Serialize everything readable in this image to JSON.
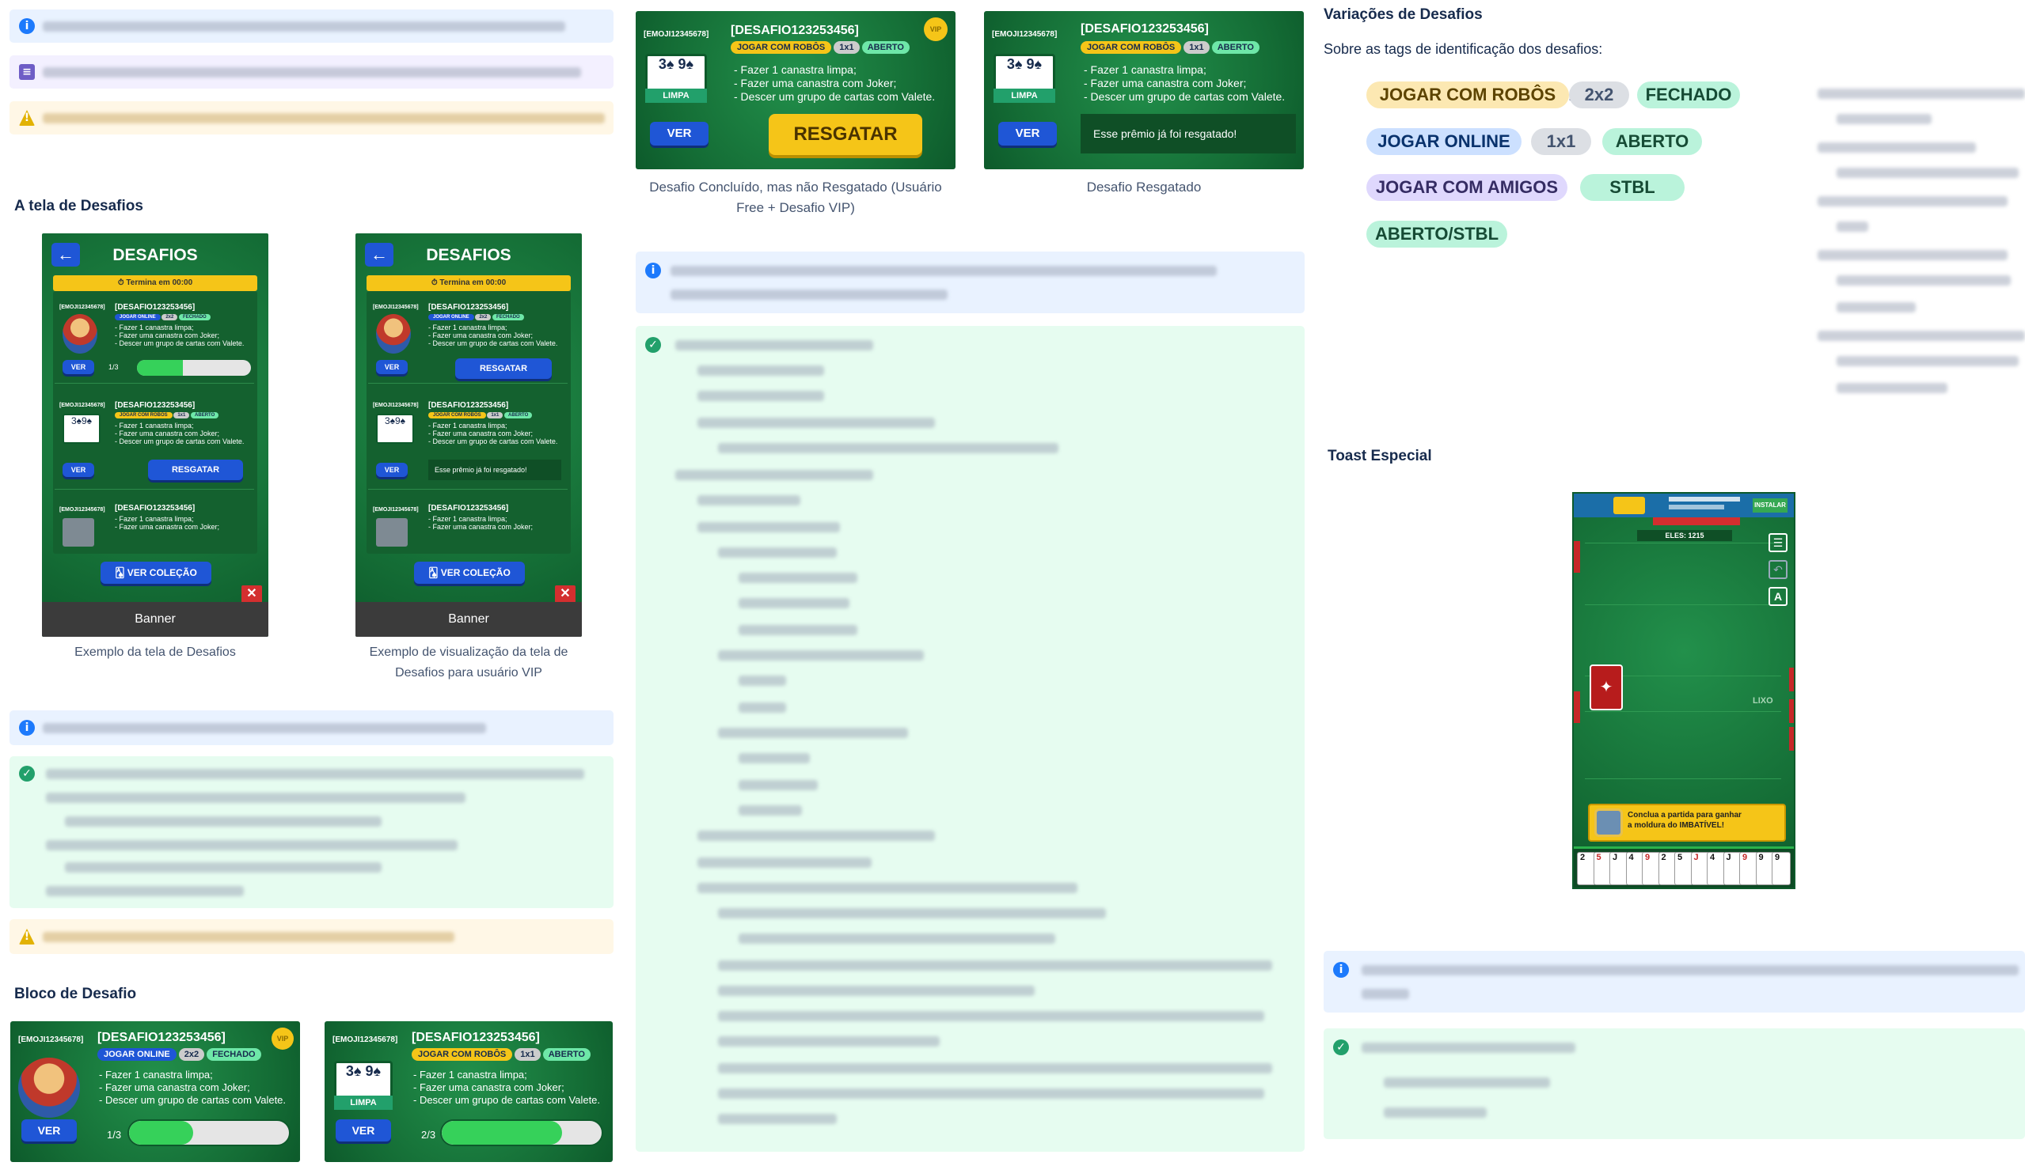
{
  "colors": {
    "info": "#1d7afc",
    "note": "#6e5dc6",
    "warn": "#e2b203",
    "success": "#22a06b",
    "felt": "#168a41",
    "verButton": "#1f56d6",
    "resgatar": "#f5c518",
    "lineGreen": "#36d15a"
  },
  "left": {
    "section_title": "A tela de Desafios",
    "phone_title": "DESAFIOS",
    "ends_label": "Termina em 00:00",
    "ver_colecao": "VER COLEÇÃO",
    "banner": "Banner",
    "resgatar": "RESGATAR",
    "resgatado": "Esse prêmio já foi resgatado!",
    "progress": "1/3",
    "caption1": "Exemplo da tela de Desafios",
    "caption2": "Exemplo de visualização da tela de Desafios para usuário VIP",
    "block_title": "Bloco de Desafio"
  },
  "challenge": {
    "emoji_id": "[EMOJI12345678]",
    "name": "[DESAFIO123253456]",
    "lines": [
      "- Fazer 1 canastra limpa;",
      "- Fazer uma canastra com Joker;",
      "- Descer um grupo de cartas com Valete."
    ],
    "limpa": "LIMPA",
    "ver": "VER",
    "resgatar": "RESGATAR",
    "resgatado": "Esse prêmio já foi resgatado!",
    "progress_a": "1/3",
    "progress_b": "2/3",
    "tags_a": [
      "JOGAR ONLINE",
      "2x2",
      "FECHADO"
    ],
    "tags_b": [
      "JOGAR COM ROBÔS",
      "1x1",
      "ABERTO"
    ],
    "tags_c": [
      "JOGAR COM ROBÔS",
      "2x2",
      "STBL"
    ],
    "vip": "VIP"
  },
  "middle": {
    "caption_unclaimed": "Desafio Concluído, mas não Resgatado (Usuário Free + Desafio VIP)",
    "caption_claimed": "Desafio Resgatado"
  },
  "right": {
    "title": "Variações de Desafios",
    "subtitle": "Sobre as tags de identificação dos desafios:",
    "tags_row1": [
      "JOGAR COM ROBÔS",
      "2x2",
      "FECHADO"
    ],
    "tags_row2": [
      "JOGAR ONLINE",
      "1x1",
      "ABERTO"
    ],
    "tags_row3": [
      "JOGAR COM AMIGOS",
      "STBL"
    ],
    "tags_row4": [
      "ABERTO/STBL"
    ],
    "toast_title": "Toast Especial",
    "game": {
      "score": "ELES: 1215",
      "lixo": "LIXO",
      "toast_text_1": "Conclua a partida para ganhar",
      "toast_text_2": "a moldura do IMBATÍVEL!",
      "ad_install": "INSTALAR",
      "a_button": "A",
      "hand": [
        "2",
        "5",
        "J",
        "4",
        "9",
        "2",
        "5",
        "J",
        "4",
        "J",
        "9",
        "9",
        "9"
      ]
    }
  }
}
